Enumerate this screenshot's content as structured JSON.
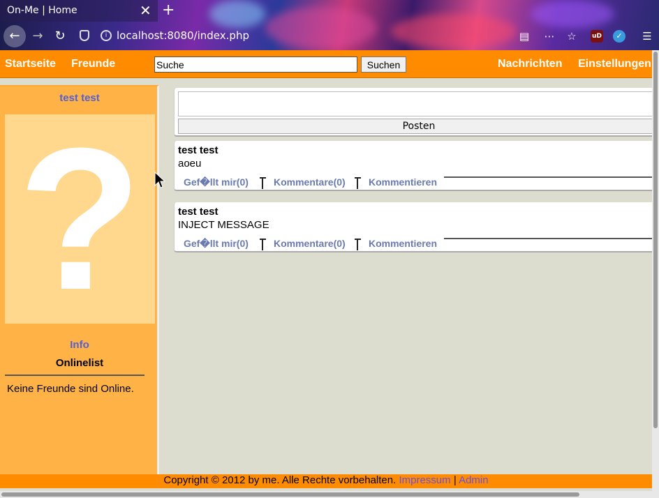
{
  "browser": {
    "tab_title": "On-Me | Home",
    "tab_close": "✕",
    "new_tab": "+",
    "url": "localhost:8080/index.php",
    "back": "←",
    "forward": "→",
    "reload": "↻"
  },
  "topnav": {
    "home": "Startseite",
    "friends": "Freunde",
    "search_value": "Suche",
    "search_button": "Suchen",
    "messages": "Nachrichten",
    "settings": "Einstellungen"
  },
  "sidebar": {
    "profile_name": "test test",
    "avatar_glyph": "?",
    "info_link": "Info",
    "online_heading": "Onlinelist",
    "online_text": "Keine Freunde sind Online."
  },
  "composer": {
    "textarea_value": "",
    "post_button": "Posten"
  },
  "posts": [
    {
      "author": "test test",
      "message": "aoeu",
      "like": "Gef�llt mir(0)",
      "comments": "Kommentare(0)",
      "comment_action": "Kommentieren"
    },
    {
      "author": "test test",
      "message": "INJECT MESSAGE",
      "like": "Gef�llt mir(0)",
      "comments": "Kommentare(0)",
      "comment_action": "Kommentieren"
    }
  ],
  "footer": {
    "copyright": "Copyright © 2012 by me. Alle Rechte vorbehalten.",
    "impressum": "Impressum",
    "separator": "|",
    "admin": "Admin"
  },
  "colors": {
    "header_orange": "#ff8c00",
    "sidebar_orange": "#ffb347",
    "link_blue": "#5560d0",
    "action_blue": "#6a7aae",
    "page_bg": "#dcdccf"
  }
}
